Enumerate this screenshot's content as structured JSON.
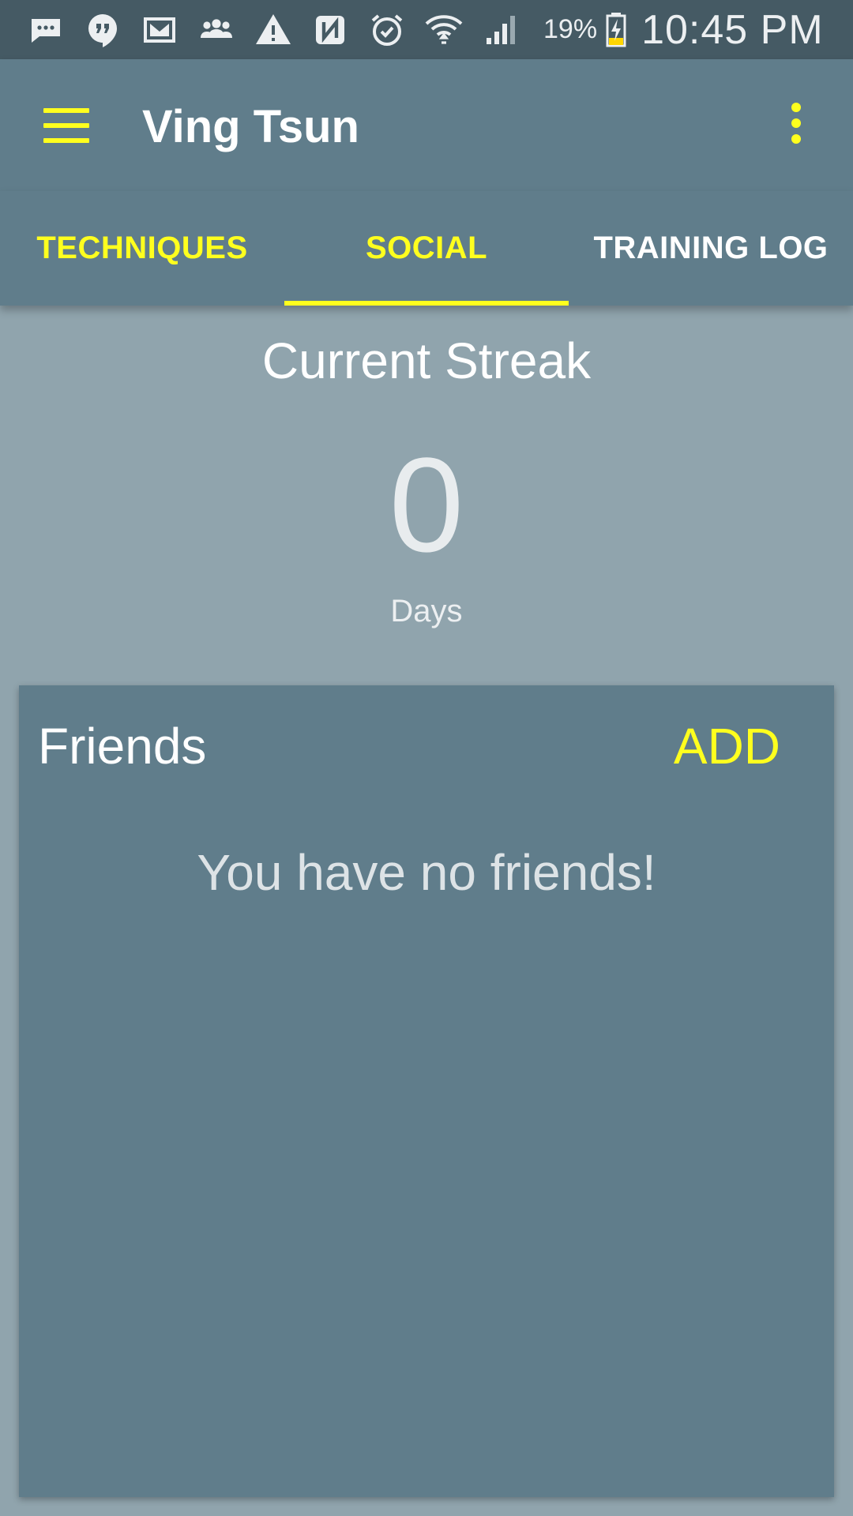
{
  "status_bar": {
    "icons": [
      "message-icon",
      "hangouts-icon",
      "gmail-icon",
      "group-icon",
      "warning-icon",
      "nfc-icon",
      "alarm-icon",
      "wifi-icon",
      "signal-icon",
      "battery-charging-icon"
    ],
    "battery_percent": "19%",
    "time": "10:45 PM"
  },
  "app_bar": {
    "title": "Ving Tsun",
    "accent_color": "#ffff1e",
    "background_color": "#607d8b"
  },
  "tabs": [
    {
      "label": "TECHNIQUES"
    },
    {
      "label": "SOCIAL",
      "selected": true
    },
    {
      "label": "TRAINING LOG"
    }
  ],
  "streak": {
    "title": "Current Streak",
    "value": "0",
    "unit": "Days"
  },
  "friends": {
    "title": "Friends",
    "add_label": "ADD",
    "empty_message": "You have no friends!"
  }
}
